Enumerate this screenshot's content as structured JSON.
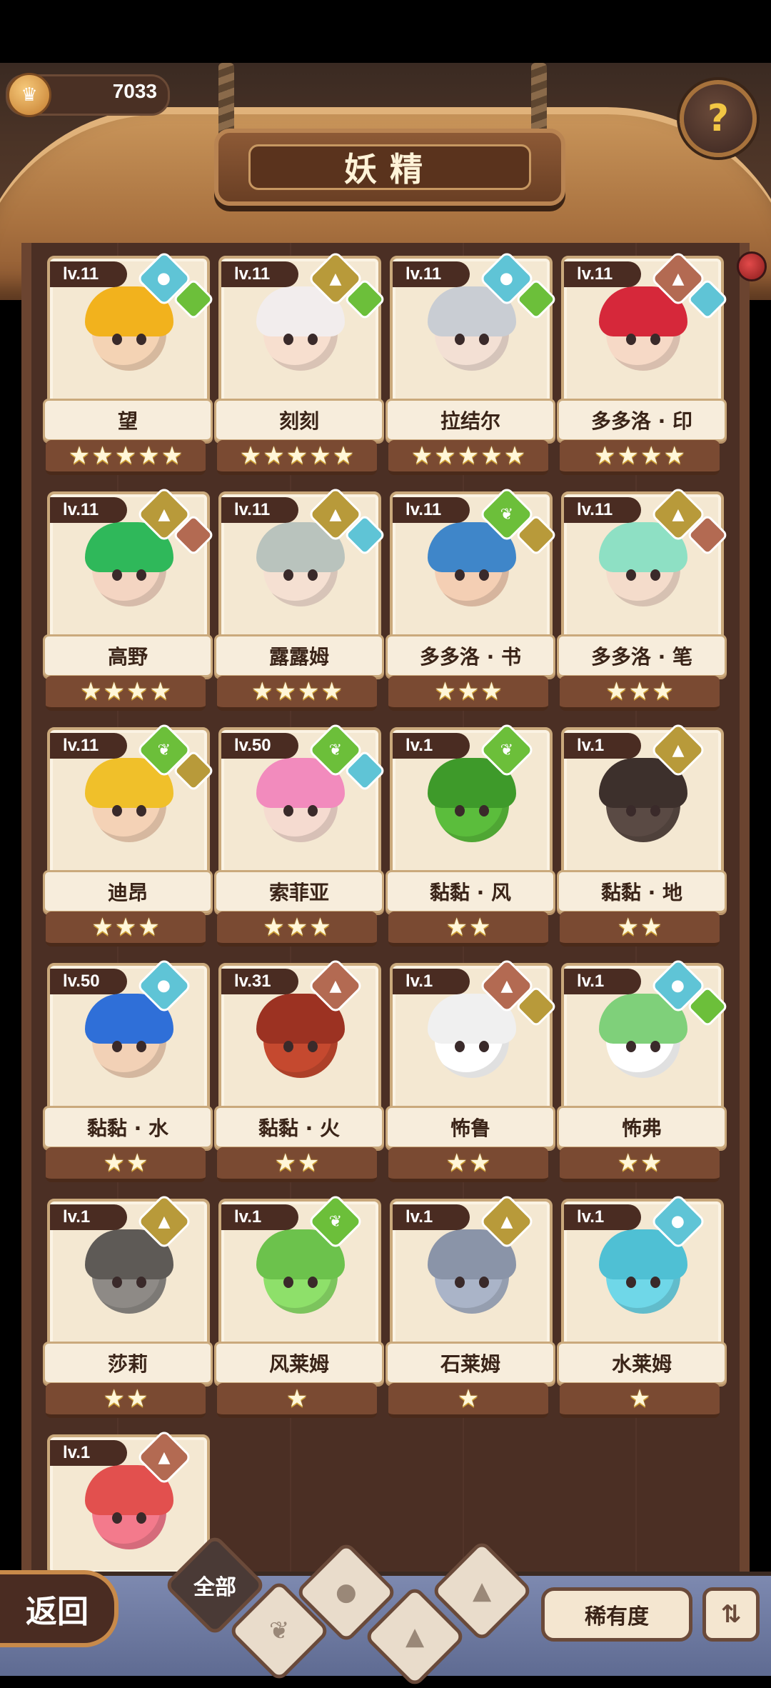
{
  "header": {
    "coins": "7033",
    "title": "妖精",
    "help_glyph": "?"
  },
  "colors": {
    "water": "#5fc4d6",
    "earth": "#b89a3a",
    "leaf": "#6cbf3a",
    "fire": "#b36a52"
  },
  "fairies": [
    {
      "level": "lv.11",
      "name": "望",
      "stars": 5,
      "elem": "water",
      "sub": "leaf",
      "skin": "#f4d3b4",
      "hair": "#f2b21d"
    },
    {
      "level": "lv.11",
      "name": "刻刻",
      "stars": 5,
      "elem": "earth",
      "sub": "leaf",
      "skin": "#f7dfcf",
      "hair": "#f2eded"
    },
    {
      "level": "lv.11",
      "name": "拉结尔",
      "stars": 5,
      "elem": "water",
      "sub": "leaf",
      "skin": "#f3e0d4",
      "hair": "#c9cdd3"
    },
    {
      "level": "lv.11",
      "name": "多多洛 · 印",
      "stars": 4,
      "elem": "fire",
      "sub": "water",
      "skin": "#f6d9c6",
      "hair": "#d6283a"
    },
    {
      "level": "lv.11",
      "name": "高野",
      "stars": 4,
      "elem": "earth",
      "sub": "fire",
      "skin": "#f4d5c2",
      "hair": "#2fb85a"
    },
    {
      "level": "lv.11",
      "name": "露露姆",
      "stars": 4,
      "elem": "earth",
      "sub": "water",
      "skin": "#f5e0d2",
      "hair": "#b9c3bd"
    },
    {
      "level": "lv.11",
      "name": "多多洛 · 书",
      "stars": 3,
      "elem": "leaf",
      "sub": "earth",
      "skin": "#f4cfb4",
      "hair": "#3f86c9"
    },
    {
      "level": "lv.11",
      "name": "多多洛 · 笔",
      "stars": 3,
      "elem": "earth",
      "sub": "fire",
      "skin": "#f4dccb",
      "hair": "#8ee0c4"
    },
    {
      "level": "lv.11",
      "name": "迪昂",
      "stars": 3,
      "elem": "leaf",
      "sub": "earth",
      "skin": "#f4d2b6",
      "hair": "#f0c02a"
    },
    {
      "level": "lv.50",
      "name": "索菲亚",
      "stars": 3,
      "elem": "leaf",
      "sub": "water",
      "skin": "#f5dbd0",
      "hair": "#f28bbd"
    },
    {
      "level": "lv.1",
      "name": "黏黏 · 风",
      "stars": 2,
      "elem": "leaf",
      "sub": "",
      "skin": "#5bbd3c",
      "hair": "#3e9a2a"
    },
    {
      "level": "lv.1",
      "name": "黏黏 · 地",
      "stars": 2,
      "elem": "earth",
      "sub": "",
      "skin": "#5a4a44",
      "hair": "#3d302c"
    },
    {
      "level": "lv.50",
      "name": "黏黏 · 水",
      "stars": 2,
      "elem": "water",
      "sub": "",
      "skin": "#f2d1b6",
      "hair": "#2f6fd8"
    },
    {
      "level": "lv.31",
      "name": "黏黏 · 火",
      "stars": 2,
      "elem": "fire",
      "sub": "",
      "skin": "#c5492f",
      "hair": "#9c3222"
    },
    {
      "level": "lv.1",
      "name": "怖鲁",
      "stars": 2,
      "elem": "fire",
      "sub": "earth",
      "skin": "#ffffff",
      "hair": "#f0f0f0"
    },
    {
      "level": "lv.1",
      "name": "怖弗",
      "stars": 2,
      "elem": "water",
      "sub": "leaf",
      "skin": "#ffffff",
      "hair": "#7fd07a"
    },
    {
      "level": "lv.1",
      "name": "莎莉",
      "stars": 2,
      "elem": "earth",
      "sub": "",
      "skin": "#8e8a86",
      "hair": "#5e5a56"
    },
    {
      "level": "lv.1",
      "name": "风莱姆",
      "stars": 1,
      "elem": "leaf",
      "sub": "",
      "skin": "#8ee06a",
      "hair": "#6cc24c"
    },
    {
      "level": "lv.1",
      "name": "石莱姆",
      "stars": 1,
      "elem": "earth",
      "sub": "",
      "skin": "#aab4c8",
      "hair": "#8a94a8"
    },
    {
      "level": "lv.1",
      "name": "水莱姆",
      "stars": 1,
      "elem": "water",
      "sub": "",
      "skin": "#6fd7e8",
      "hair": "#4fc0d4"
    },
    {
      "level": "lv.1",
      "name": "",
      "stars": 0,
      "elem": "fire",
      "sub": "",
      "skin": "#f37a8c",
      "hair": "#e2504e"
    }
  ],
  "bottom": {
    "back_label": "返回",
    "tab_all_label": "全部",
    "rarity_label": "稀有度"
  }
}
